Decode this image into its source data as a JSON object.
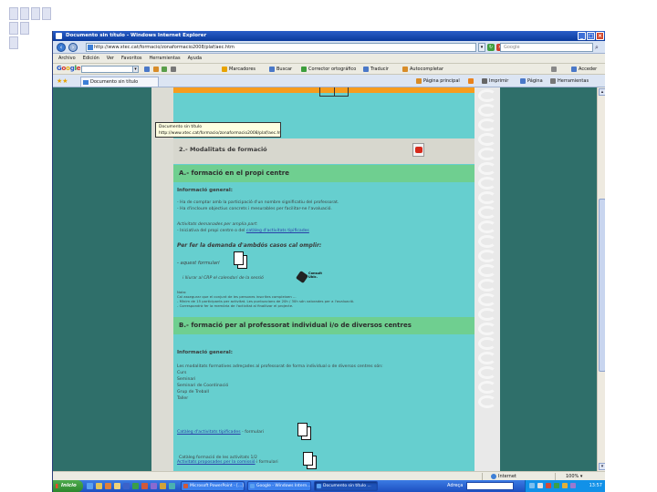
{
  "window": {
    "title": "Documento sin título - Windows Internet Explorer"
  },
  "address_bar": {
    "url": "http://www.xtec.cat/formacio/zonaformacio2008/plaf/aec.htm",
    "search_placeholder": "Google"
  },
  "menu": [
    "Archivo",
    "Edición",
    "Ver",
    "Favoritos",
    "Herramientas",
    "Ayuda"
  ],
  "google_toolbar": {
    "logo": "Google",
    "items": [
      "Marcadores",
      "Buscar",
      "Corrector ortográfico",
      "Traducir",
      "Autocompletar"
    ],
    "right_items": [
      "Acceder"
    ]
  },
  "tab": {
    "label": "Documento sin título"
  },
  "command_bar": [
    "Página principal",
    "Imprimir",
    "Página",
    "Herramientas"
  ],
  "tooltip": {
    "line1": "Documento sin título",
    "line2": "http://www.xtec.cat/formacio/zonaformacio2008/plaf/aec.htm"
  },
  "page": {
    "section_title": "2.- Modalitats de formació",
    "section_a": {
      "title": "A.- formació en el propi centre",
      "info_heading": "Informació general:",
      "bullets": [
        "- Ha de comptar amb la participació d'un nombre significatiu del professorat.",
        "- Ha d'incloure objectius concrets i mesurables per facilitar-ne l'avaluació."
      ],
      "offer_lead": "Activitats demanades per amplia part:",
      "offer_text": "- Iniciativa del propi centre o del",
      "offer_link": "catàleg d'activitats tipificades",
      "demand_heading": "Per fer la demanda d'ambdós casos cal omplir:",
      "form_label": "- aquest formulari",
      "consult_label": "i lliurar al CRP el calendari de la sessió",
      "consult_icon_label": "Consult Ubic.",
      "note_label": "Nota:",
      "notes": [
        "Cal assegurar que el conjunt de les persones inscrites compleixen ...",
        "- Mínim de 15 participants per activitat. Les puntuacions de 20h / 30h són valorades per a l'avaluació.",
        "- Correspondrà fer la memòria de l'activitat al finalitzar el projecte."
      ]
    },
    "section_b": {
      "title": "B.- formació per al professorat individual i/o de diversos centres",
      "info_heading": "Informació general:",
      "intro": "Les modalitats formatives adreçades al professorat de forma individual o de diversos centres són:",
      "modalities": [
        "Curs",
        "Seminari",
        "Seminari de Coordinació",
        "Grup de Treball",
        "Taller"
      ],
      "catalog_link": "Catàleg d'activitats tipificades",
      "catalog_text": "- formulari",
      "proposed_link": "Activitats proposades per la comissió",
      "proposed_text": "i formulari",
      "footer_text": "Catàleg formació de les activitats 1/2"
    }
  },
  "status_bar": {
    "zone": "Internet",
    "zoom": "100%"
  },
  "taskbar": {
    "start_label": "Inicio",
    "tasks": [
      "Microsoft PowerPoint - [...]",
      "Google - Windows Intern...",
      "Documento sin título ..."
    ],
    "address_label": "Adreça",
    "clock": "13:57"
  },
  "colors": {
    "page_bg": "#66cfcf",
    "section_bar": "#6fcf90",
    "desktop": "#2f6f6a",
    "accent_orange": "#f79c1d"
  }
}
